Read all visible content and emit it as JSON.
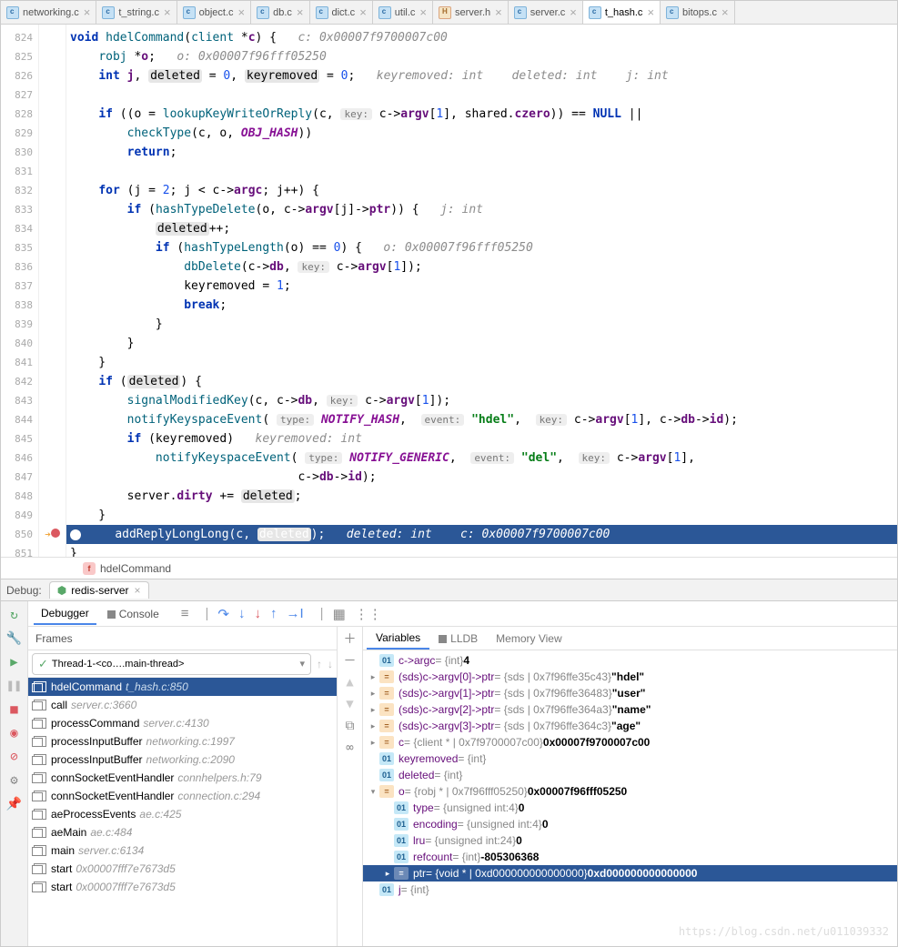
{
  "tabs": [
    {
      "name": "networking.c",
      "type": "c"
    },
    {
      "name": "t_string.c",
      "type": "c"
    },
    {
      "name": "object.c",
      "type": "c"
    },
    {
      "name": "db.c",
      "type": "c"
    },
    {
      "name": "dict.c",
      "type": "c"
    },
    {
      "name": "util.c",
      "type": "c"
    },
    {
      "name": "server.h",
      "type": "h"
    },
    {
      "name": "server.c",
      "type": "c"
    },
    {
      "name": "t_hash.c",
      "type": "c",
      "active": true
    },
    {
      "name": "bitops.c",
      "type": "c"
    }
  ],
  "line_start": 824,
  "line_end": 851,
  "exec_line": 850,
  "code_lines": [
    {
      "n": 824,
      "html": "<span class='kw'>void</span> <span class='fn'>hdelCommand</span>(<span class='ty'>client</span> *<span class='var'>c</span>) {   <span class='hint'>c: 0x00007f9700007c00</span>"
    },
    {
      "n": 825,
      "html": "    <span class='ty'>robj</span> *<span class='var'>o</span>;   <span class='hint'>o: 0x00007f96fff05250</span>"
    },
    {
      "n": 826,
      "html": "    <span class='kw'>int</span> <span class='var'>j</span>, <span class='boxed'>deleted</span> = <span class='num'>0</span>, <span class='boxed'>keyremoved</span> = <span class='num'>0</span>;   <span class='hint'>keyremoved: int    deleted: int    j: int</span>"
    },
    {
      "n": 827,
      "html": ""
    },
    {
      "n": 828,
      "html": "    <span class='kw'>if</span> ((o = <span class='fn'>lookupKeyWriteOrReply</span>(c, <span class='hint-box'>key:</span> c-&gt;<span class='var'>argv</span>[<span class='num'>1</span>], shared.<span class='var'>czero</span>)) == <span class='kw'>NULL</span> ||"
    },
    {
      "n": 829,
      "html": "        <span class='fn'>checkType</span>(c, o, <span class='const'>OBJ_HASH</span>))"
    },
    {
      "n": 830,
      "html": "        <span class='kw'>return</span>;"
    },
    {
      "n": 831,
      "html": ""
    },
    {
      "n": 832,
      "html": "    <span class='kw'>for</span> (j = <span class='num'>2</span>; j &lt; c-&gt;<span class='var'>argc</span>; j++) {"
    },
    {
      "n": 833,
      "html": "        <span class='kw'>if</span> (<span class='fn'>hashTypeDelete</span>(o, c-&gt;<span class='var'>argv</span>[j]-&gt;<span class='var'>ptr</span>)) {   <span class='hint'>j: int</span>"
    },
    {
      "n": 834,
      "html": "            <span class='boxed'>deleted</span>++;"
    },
    {
      "n": 835,
      "html": "            <span class='kw'>if</span> (<span class='fn'>hashTypeLength</span>(o) == <span class='num'>0</span>) {   <span class='hint'>o: 0x00007f96fff05250</span>"
    },
    {
      "n": 836,
      "html": "                <span class='fn'>dbDelete</span>(c-&gt;<span class='var'>db</span>, <span class='hint-box'>key:</span> c-&gt;<span class='var'>argv</span>[<span class='num'>1</span>]);"
    },
    {
      "n": 837,
      "html": "                keyremoved = <span class='num'>1</span>;"
    },
    {
      "n": 838,
      "html": "                <span class='kw'>break</span>;"
    },
    {
      "n": 839,
      "html": "            }"
    },
    {
      "n": 840,
      "html": "        }"
    },
    {
      "n": 841,
      "html": "    }"
    },
    {
      "n": 842,
      "html": "    <span class='kw'>if</span> (<span class='boxed'>deleted</span>) {"
    },
    {
      "n": 843,
      "html": "        <span class='fn'>signalModifiedKey</span>(c, c-&gt;<span class='var'>db</span>, <span class='hint-box'>key:</span> c-&gt;<span class='var'>argv</span>[<span class='num'>1</span>]);"
    },
    {
      "n": 844,
      "html": "        <span class='fn'>notifyKeyspaceEvent</span>( <span class='hint-box'>type:</span> <span class='const'>NOTIFY_HASH</span>,  <span class='hint-box'>event:</span> <span class='str'>\"hdel\"</span>,  <span class='hint-box'>key:</span> c-&gt;<span class='var'>argv</span>[<span class='num'>1</span>], c-&gt;<span class='var'>db</span>-&gt;<span class='var'>id</span>);"
    },
    {
      "n": 845,
      "html": "        <span class='kw'>if</span> (keyremoved)   <span class='hint'>keyremoved: int</span>"
    },
    {
      "n": 846,
      "html": "            <span class='fn'>notifyKeyspaceEvent</span>( <span class='hint-box'>type:</span> <span class='const'>NOTIFY_GENERIC</span>,  <span class='hint-box'>event:</span> <span class='str'>\"del\"</span>,  <span class='hint-box'>key:</span> c-&gt;<span class='var'>argv</span>[<span class='num'>1</span>],"
    },
    {
      "n": 847,
      "html": "                                c-&gt;<span class='var'>db</span>-&gt;<span class='var'>id</span>);"
    },
    {
      "n": 848,
      "html": "        server.<span class='var'>dirty</span> += <span class='boxed'>deleted</span>;"
    },
    {
      "n": 849,
      "html": "    }"
    },
    {
      "n": 850,
      "hl": true,
      "html": "    <span class='fn'>addReplyLongLong</span>(c, <span class='boxed'>deleted</span>);   <span class='hint'>deleted: int    c: 0x00007f9700007c00</span>"
    },
    {
      "n": 851,
      "html": "}"
    }
  ],
  "breadcrumb": {
    "icon": "f",
    "text": "hdelCommand"
  },
  "debug": {
    "label": "Debug:",
    "session": "redis-server",
    "tabs": {
      "debugger": "Debugger",
      "console": "Console"
    },
    "frames_label": "Frames",
    "thread": "Thread-1-<co….main-thread>",
    "frames": [
      {
        "fn": "hdelCommand",
        "loc": "t_hash.c:850",
        "sel": true
      },
      {
        "fn": "call",
        "loc": "server.c:3660"
      },
      {
        "fn": "processCommand",
        "loc": "server.c:4130"
      },
      {
        "fn": "processInputBuffer",
        "loc": "networking.c:1997"
      },
      {
        "fn": "processInputBuffer",
        "loc": "networking.c:2090"
      },
      {
        "fn": "connSocketEventHandler",
        "loc": "connhelpers.h:79"
      },
      {
        "fn": "connSocketEventHandler",
        "loc": "connection.c:294"
      },
      {
        "fn": "aeProcessEvents",
        "loc": "ae.c:425"
      },
      {
        "fn": "aeMain",
        "loc": "ae.c:484"
      },
      {
        "fn": "main",
        "loc": "server.c:6134"
      },
      {
        "fn": "start",
        "loc": "0x00007fff7e7673d5"
      },
      {
        "fn": "start",
        "loc": "0x00007fff7e7673d5"
      }
    ],
    "vars_tabs": {
      "variables": "Variables",
      "lldb": "LLDB",
      "mem": "Memory View"
    },
    "vars": [
      {
        "lvl": 0,
        "exp": "",
        "ic": "01",
        "name": "c->argc",
        "type": " = {int} ",
        "val": "4"
      },
      {
        "lvl": 0,
        "exp": ">",
        "ic": "=",
        "ico": "or",
        "name": "(sds)c->argv[0]->ptr",
        "type": " = {sds | 0x7f96ffe35c43} ",
        "val": "\"hdel\""
      },
      {
        "lvl": 0,
        "exp": ">",
        "ic": "=",
        "ico": "or",
        "name": "(sds)c->argv[1]->ptr",
        "type": " = {sds | 0x7f96ffe36483} ",
        "val": "\"user\""
      },
      {
        "lvl": 0,
        "exp": ">",
        "ic": "=",
        "ico": "or",
        "name": "(sds)c->argv[2]->ptr",
        "type": " = {sds | 0x7f96ffe364a3} ",
        "val": "\"name\""
      },
      {
        "lvl": 0,
        "exp": ">",
        "ic": "=",
        "ico": "or",
        "name": "(sds)c->argv[3]->ptr",
        "type": " = {sds | 0x7f96ffe364c3} ",
        "val": "\"age\""
      },
      {
        "lvl": 0,
        "exp": ">",
        "ic": "=",
        "ico": "or",
        "name": "c",
        "type": " = {client * | 0x7f9700007c00} ",
        "val": "0x00007f9700007c00"
      },
      {
        "lvl": 0,
        "exp": "",
        "ic": "01",
        "name": "keyremoved",
        "type": " = {int}",
        "val": ""
      },
      {
        "lvl": 0,
        "exp": "",
        "ic": "01",
        "name": "deleted",
        "type": " = {int}",
        "val": ""
      },
      {
        "lvl": 0,
        "exp": "v",
        "ic": "=",
        "ico": "or",
        "name": "o",
        "type": " = {robj * | 0x7f96fff05250} ",
        "val": "0x00007f96fff05250"
      },
      {
        "lvl": 1,
        "exp": "",
        "ic": "01",
        "name": "type",
        "type": " = {unsigned int:4} ",
        "val": "0"
      },
      {
        "lvl": 1,
        "exp": "",
        "ic": "01",
        "name": "encoding",
        "type": " = {unsigned int:4} ",
        "val": "0"
      },
      {
        "lvl": 1,
        "exp": "",
        "ic": "01",
        "name": "lru",
        "type": " = {unsigned int:24} ",
        "val": "0"
      },
      {
        "lvl": 1,
        "exp": "",
        "ic": "01",
        "name": "refcount",
        "type": " = {int} ",
        "val": "-805306368"
      },
      {
        "lvl": 1,
        "exp": ">",
        "ic": "=",
        "ico": "or",
        "name": "ptr",
        "type": " = {void * | 0xd000000000000000} ",
        "val": "0xd000000000000000",
        "sel": true
      },
      {
        "lvl": 0,
        "exp": "",
        "ic": "01",
        "name": "j",
        "type": " = {int}",
        "val": ""
      }
    ]
  },
  "watermark": "https://blog.csdn.net/u011039332"
}
